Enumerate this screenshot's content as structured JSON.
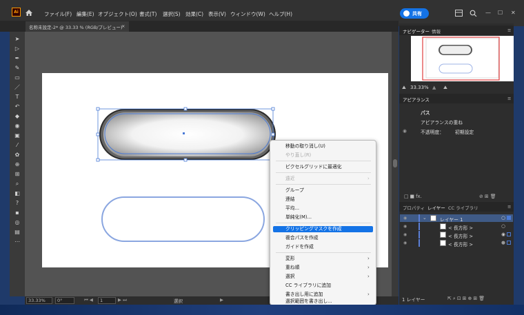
{
  "menubar": {
    "app_logo": "Ai",
    "items": [
      "ファイル(F)",
      "編集(E)",
      "オブジェクト(O)",
      "書式(T)",
      "選択(S)",
      "効果(C)",
      "表示(V)",
      "ウィンドウ(W)",
      "ヘルプ(H)"
    ],
    "share_label": "共有",
    "window_controls": [
      "—",
      "☐",
      "✕"
    ]
  },
  "document_tab": {
    "title": "名称未設定-2* @ 33.33 % (RGB/プレビュー)",
    "close": "×"
  },
  "navigator": {
    "tabs": [
      "ナビゲーター",
      "情報"
    ],
    "zoom": "33.33%"
  },
  "appearance": {
    "tab": "アピアランス",
    "rows": [
      "パス",
      "アピアランスの重ね",
      "不透明度：",
      "初期設定"
    ]
  },
  "layers_panel": {
    "tabs": [
      "プロパティ",
      "レイヤー",
      "CC ライブラリ"
    ],
    "layers": [
      {
        "name": "レイヤー 1",
        "selected": true
      },
      {
        "name": "< 長方形 >",
        "selected": false
      },
      {
        "name": "< 長方形 >",
        "selected": false
      },
      {
        "name": "< 長方形 >",
        "selected": false
      }
    ],
    "footer": "1 レイヤー"
  },
  "statusbar": {
    "zoom": "33.33%",
    "rotation": "0°",
    "artboard": "1",
    "tool": "選択"
  },
  "context_menu": {
    "items": [
      {
        "label": "移動の取り消し(U)",
        "disabled": false,
        "submenu": false
      },
      {
        "label": "やり直し(R)",
        "disabled": true,
        "submenu": false
      },
      {
        "label": "ピクセルグリッドに最適化",
        "disabled": false,
        "submenu": false
      },
      {
        "label": "遠近",
        "disabled": true,
        "submenu": true
      },
      {
        "label": "グループ",
        "disabled": false,
        "submenu": false
      },
      {
        "label": "連結",
        "disabled": false,
        "submenu": false
      },
      {
        "label": "平均...",
        "disabled": false,
        "submenu": false
      },
      {
        "label": "単純化(M)...",
        "disabled": false,
        "submenu": false
      },
      {
        "label": "クリッピングマスクを作成",
        "disabled": false,
        "submenu": false,
        "highlighted": true
      },
      {
        "label": "複合パスを作成",
        "disabled": false,
        "submenu": false
      },
      {
        "label": "ガイドを作成",
        "disabled": false,
        "submenu": false
      },
      {
        "label": "変形",
        "disabled": false,
        "submenu": true
      },
      {
        "label": "重ね順",
        "disabled": false,
        "submenu": true
      },
      {
        "label": "選択",
        "disabled": false,
        "submenu": true
      },
      {
        "label": "CC ライブラリに追加",
        "disabled": false,
        "submenu": false
      },
      {
        "label": "書き出し用に追加",
        "disabled": false,
        "submenu": true
      },
      {
        "label": "選択範囲を書き出し...",
        "disabled": false,
        "submenu": false
      }
    ]
  },
  "colors": {
    "accent": "#1473e6",
    "selection": "#4a7ad6",
    "pill_outline": "#8aa6e0"
  }
}
